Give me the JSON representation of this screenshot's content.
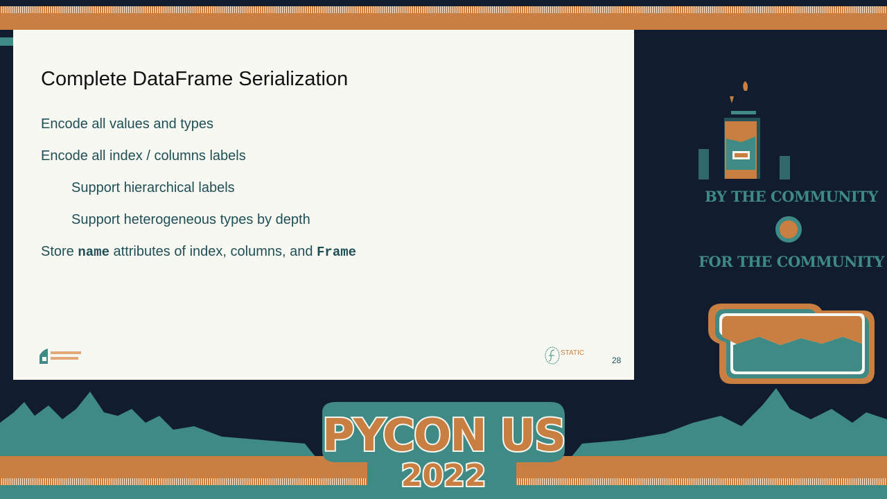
{
  "slide": {
    "title": "Complete DataFrame Serialization",
    "bullets": [
      {
        "text": "Encode all values and types"
      },
      {
        "text": "Encode all index / columns labels"
      },
      {
        "text": "Support hierarchical labels"
      },
      {
        "text": "Support heterogeneous types by depth"
      },
      {
        "pre": "Store ",
        "code1": "name",
        "mid": " attributes of index, columns, and ",
        "code2": "Frame"
      }
    ],
    "page_number": "28",
    "logo_right_text": "STATIC"
  },
  "sidebar": {
    "tagline_top": "BY THE COMMUNITY",
    "tagline_bottom": "FOR THE COMMUNITY"
  },
  "banner": {
    "line1": "PYCON US",
    "line2": "2022"
  },
  "colors": {
    "navy": "#111d2f",
    "orange": "#c97f42",
    "teal": "#3f8a85",
    "cream": "#f7f8f2"
  }
}
